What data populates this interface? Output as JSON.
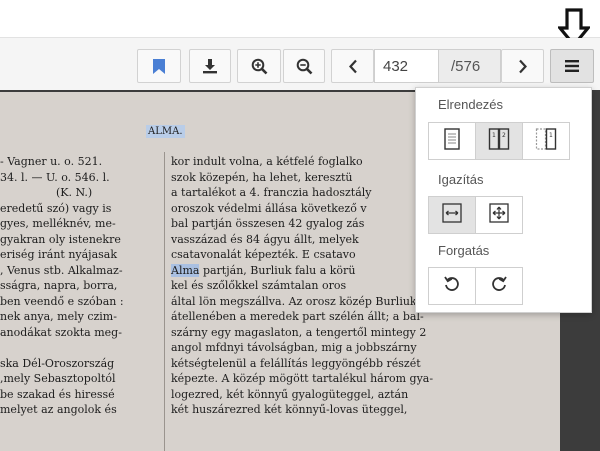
{
  "toolbar": {
    "page_current": "432",
    "page_total": "/576",
    "icons": [
      "bookmark-icon",
      "download-icon",
      "zoom-in-icon",
      "zoom-out-icon",
      "chevron-left-icon",
      "chevron-right-icon",
      "menu-icon"
    ],
    "accent_color": "#4a7fd4"
  },
  "panel": {
    "layout_title": "Elrendezés",
    "align_title": "Igazítás",
    "rotate_title": "Forgatás",
    "layout_options": [
      "single-page-icon",
      "two-page-icon",
      "two-page-cover-icon"
    ],
    "align_options": [
      "fit-width-icon",
      "fit-page-icon"
    ],
    "rotate_options": [
      "rotate-left-icon",
      "rotate-right-icon"
    ]
  },
  "document": {
    "heading": "ALMA.",
    "left_lines": [
      "- Vagner u. o. 521.",
      "34. l. — U. o. 546. l.",
      "                (K. N.)",
      "eredetű szó) vagy is",
      "gyes, melléknév, me-",
      "gyakran oly istenekre",
      "eriség iránt nyájasak",
      ", Venus stb. Alkalmaz-",
      "sságra, napra, borra,",
      "ben veendő e szóban :",
      "nek anya, mely czim-",
      "anodákat szokta meg-",
      "",
      "ska Dél-Oroszország",
      ",mely Sebasztopoltól",
      "be szakad és hiressé",
      "melyet az angolok és"
    ],
    "right_lines": [
      "kor indult volna, a kétfelé foglalko",
      "szok közepén, ha lehet, keresztü",
      "a tartalékot a 4. franczia hadosztály",
      "oroszok védelmi állása következő v",
      "bal partján összesen 42 gyalog zás",
      "vasszázad és 84 ágyu állt, melyek",
      "csatavonalát képezték. E csatavo",
      "Alma partján, Burliuk falu a körü",
      "kel és szőlőkkel számtalan oros",
      "által lön megszállva. Az orosz közép Burliuk falu",
      "átellenében a meredek part szélén állt; a bal-",
      "szárny egy magaslaton, a tengertől mintegy 2",
      "angol mfdnyi távolságban, mig a jobbszárny",
      "kétségtelenül a felállítás leggyöngébb részét",
      "képezte. A közép mögött tartalékul három gya-",
      "logezred, két könnyű gyalogüteggel, aztán",
      "két huszárezred két könnyű-lovas üteggel,"
    ]
  }
}
